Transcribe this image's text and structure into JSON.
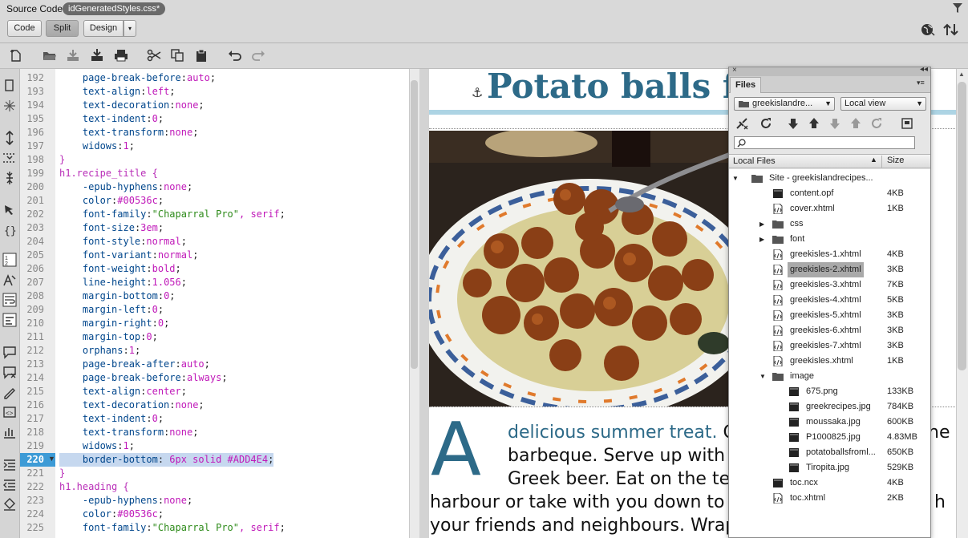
{
  "header": {
    "source_code_label": "Source Code",
    "active_file_tab": "idGeneratedStyles.css*"
  },
  "view_buttons": {
    "code": "Code",
    "split": "Split",
    "design": "Design",
    "design_arrow": "▾"
  },
  "code": {
    "current_line": 220,
    "lines": [
      {
        "n": 192,
        "text": "    page-break-before:auto;"
      },
      {
        "n": 193,
        "text": "    text-align:left;"
      },
      {
        "n": 194,
        "text": "    text-decoration:none;"
      },
      {
        "n": 195,
        "text": "    text-indent:0;"
      },
      {
        "n": 196,
        "text": "    text-transform:none;"
      },
      {
        "n": 197,
        "text": "    widows:1;"
      },
      {
        "n": 198,
        "text": "}"
      },
      {
        "n": 199,
        "text": "h1.recipe_title {"
      },
      {
        "n": 200,
        "text": "    -epub-hyphens:none;"
      },
      {
        "n": 201,
        "text": "    color:#00536c;"
      },
      {
        "n": 202,
        "text": "    font-family:\"Chaparral Pro\", serif;"
      },
      {
        "n": 203,
        "text": "    font-size:3em;"
      },
      {
        "n": 204,
        "text": "    font-style:normal;"
      },
      {
        "n": 205,
        "text": "    font-variant:normal;"
      },
      {
        "n": 206,
        "text": "    font-weight:bold;"
      },
      {
        "n": 207,
        "text": "    line-height:1.056;"
      },
      {
        "n": 208,
        "text": "    margin-bottom:0;"
      },
      {
        "n": 209,
        "text": "    margin-left:0;"
      },
      {
        "n": 210,
        "text": "    margin-right:0;"
      },
      {
        "n": 211,
        "text": "    margin-top:0;"
      },
      {
        "n": 212,
        "text": "    orphans:1;"
      },
      {
        "n": 213,
        "text": "    page-break-after:auto;"
      },
      {
        "n": 214,
        "text": "    page-break-before:always;"
      },
      {
        "n": 215,
        "text": "    text-align:center;"
      },
      {
        "n": 216,
        "text": "    text-decoration:none;"
      },
      {
        "n": 217,
        "text": "    text-indent:0;"
      },
      {
        "n": 218,
        "text": "    text-transform:none;"
      },
      {
        "n": 219,
        "text": "    widows:1;"
      },
      {
        "n": 220,
        "text": "    border-bottom: 6px solid #ADD4E4;"
      },
      {
        "n": 221,
        "text": "}"
      },
      {
        "n": 222,
        "text": "h1.heading {"
      },
      {
        "n": 223,
        "text": "    -epub-hyphens:none;"
      },
      {
        "n": 224,
        "text": "    color:#00536c;"
      },
      {
        "n": 225,
        "text": "    font-family:\"Chaparral Pro\", serif;"
      }
    ]
  },
  "design": {
    "title": "Potato balls fr",
    "drop_cap": "A",
    "lead_text": "delicious summer treat.",
    "line1_tail": "C",
    "line1_end": "he",
    "line2": "barbeque. Serve up with l",
    "line3": "Greek beer. Eat on the ter",
    "line4": "harbour or take with you down to t",
    "line4_end": "h",
    "line5": "your friends and neighbours. Wrap",
    "title_color": "#2d6a88",
    "rule_color": "#ADD4E4"
  },
  "files_panel": {
    "tab": "Files",
    "site_dropdown": "greekislandre...",
    "view_dropdown": "Local view",
    "search_placeholder": "",
    "col_local": "Local Files",
    "col_size": "Size",
    "rows": [
      {
        "name": "Site - greekislandrecipes...",
        "size": "",
        "type": "site",
        "indent": 0,
        "twisty": "▼"
      },
      {
        "name": "content.opf",
        "size": "4KB",
        "type": "file",
        "indent": 1,
        "twisty": ""
      },
      {
        "name": "cover.xhtml",
        "size": "1KB",
        "type": "html",
        "indent": 1,
        "twisty": ""
      },
      {
        "name": "css",
        "size": "",
        "type": "folder",
        "indent": 1,
        "twisty": "▶"
      },
      {
        "name": "font",
        "size": "",
        "type": "folder",
        "indent": 1,
        "twisty": "▶"
      },
      {
        "name": "greekisles-1.xhtml",
        "size": "4KB",
        "type": "html",
        "indent": 1,
        "twisty": ""
      },
      {
        "name": "greekisles-2.xhtml",
        "size": "3KB",
        "type": "html",
        "indent": 1,
        "twisty": "",
        "selected": true
      },
      {
        "name": "greekisles-3.xhtml",
        "size": "7KB",
        "type": "html",
        "indent": 1,
        "twisty": ""
      },
      {
        "name": "greekisles-4.xhtml",
        "size": "5KB",
        "type": "html",
        "indent": 1,
        "twisty": ""
      },
      {
        "name": "greekisles-5.xhtml",
        "size": "3KB",
        "type": "html",
        "indent": 1,
        "twisty": ""
      },
      {
        "name": "greekisles-6.xhtml",
        "size": "3KB",
        "type": "html",
        "indent": 1,
        "twisty": ""
      },
      {
        "name": "greekisles-7.xhtml",
        "size": "3KB",
        "type": "html",
        "indent": 1,
        "twisty": ""
      },
      {
        "name": "greekisles.xhtml",
        "size": "1KB",
        "type": "html",
        "indent": 1,
        "twisty": ""
      },
      {
        "name": "image",
        "size": "",
        "type": "folder",
        "indent": 1,
        "twisty": "▼"
      },
      {
        "name": "675.png",
        "size": "133KB",
        "type": "file",
        "indent": 2,
        "twisty": ""
      },
      {
        "name": "greekrecipes.jpg",
        "size": "784KB",
        "type": "file",
        "indent": 2,
        "twisty": ""
      },
      {
        "name": "moussaka.jpg",
        "size": "600KB",
        "type": "file",
        "indent": 2,
        "twisty": ""
      },
      {
        "name": "P1000825.jpg",
        "size": "4.83MB",
        "type": "file",
        "indent": 2,
        "twisty": ""
      },
      {
        "name": "potatoballsfroml...",
        "size": "650KB",
        "type": "file",
        "indent": 2,
        "twisty": ""
      },
      {
        "name": "Tiropita.jpg",
        "size": "529KB",
        "type": "file",
        "indent": 2,
        "twisty": ""
      },
      {
        "name": "toc.ncx",
        "size": "4KB",
        "type": "file",
        "indent": 1,
        "twisty": ""
      },
      {
        "name": "toc.xhtml",
        "size": "2KB",
        "type": "html",
        "indent": 1,
        "twisty": ""
      }
    ]
  }
}
